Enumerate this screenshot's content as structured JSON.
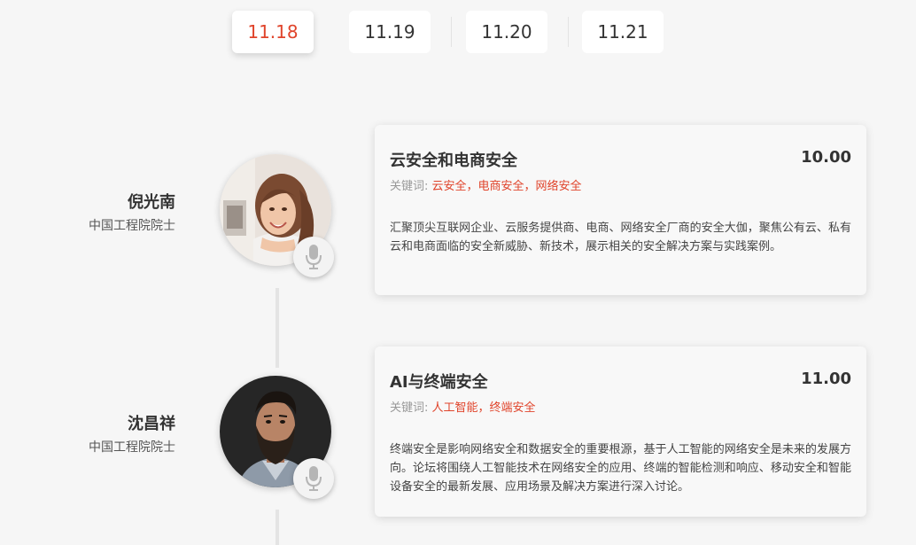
{
  "date_tabs": [
    "11.18",
    "11.19",
    "11.20",
    "11.21"
  ],
  "active_tab": "11.18",
  "sessions": [
    {
      "speaker_name": "倪光南",
      "speaker_title": "中国工程院院士",
      "avatar_icon": "speaker-photo-woman",
      "mic_icon": "microphone-icon",
      "title": "云安全和电商安全",
      "time": "10.00",
      "keywords_label": "关键词:",
      "keywords": "云安全，电商安全，网络安全",
      "description": "汇聚顶尖互联网企业、云服务提供商、电商、网络安全厂商的安全大伽，聚焦公有云、私有云和电商面临的安全新威胁、新技术，展示相关的安全解决方案与实践案例。"
    },
    {
      "speaker_name": "沈昌祥",
      "speaker_title": "中国工程院院士",
      "avatar_icon": "speaker-photo-man",
      "mic_icon": "microphone-icon",
      "title": "AI与终端安全",
      "time": "11.00",
      "keywords_label": "关键词:",
      "keywords": "人工智能，终端安全",
      "description": "终端安全是影响网络安全和数据安全的重要根源，基于人工智能的网络安全是未来的发展方向。论坛将围绕人工智能技术在网络安全的应用、终端的智能检测和响应、移动安全和智能设备安全的最新发展、应用场景及解决方案进行深入讨论。"
    }
  ],
  "colors": {
    "accent": "#e0442b",
    "background": "#f6f6f6"
  }
}
